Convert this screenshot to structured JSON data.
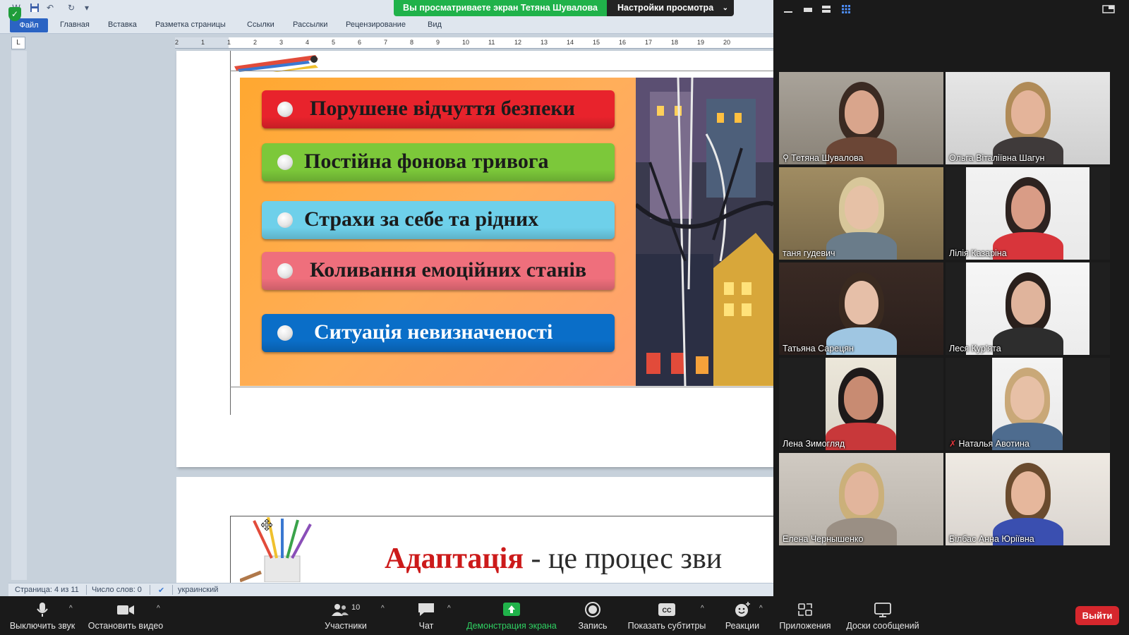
{
  "banner": {
    "viewing_text": "Вы просматриваете экран Тетяна Шувалова",
    "view_settings_label": "Настройки просмотра"
  },
  "word": {
    "tabs": {
      "file": "Файл",
      "home": "Главная",
      "insert": "Вставка",
      "layout": "Разметка страницы",
      "references": "Ссылки",
      "mailings": "Рассылки",
      "review": "Рецензирование",
      "view": "Вид"
    },
    "ruler_corner": "L",
    "ruler_numbers": [
      "2",
      "1",
      "1",
      "2",
      "3",
      "4",
      "5",
      "6",
      "7",
      "8",
      "9",
      "10",
      "11",
      "12",
      "13",
      "14",
      "15",
      "16",
      "17",
      "18",
      "19",
      "20"
    ],
    "slide_items": [
      {
        "text": "Порушене відчуття безпеки",
        "color": "#e8232c"
      },
      {
        "text": "Постійна фонова тривога",
        "color": "#7cc83a"
      },
      {
        "text": "Страхи за себе та рідних",
        "color": "#6ed0ea"
      },
      {
        "text": "Коливання емоційних станів",
        "color": "#ef6f7c"
      },
      {
        "text": "Ситуація невизначеності",
        "color": "#0a6ec8"
      }
    ],
    "page2_heading_word": "Адаптація",
    "page2_heading_rest": " -   це процес зви",
    "status": {
      "page": "Страница: 4 из 11",
      "words": "Число слов: 0",
      "language": "украинский"
    }
  },
  "participants": [
    {
      "name": "Тетяна Шувалова",
      "icon": "pin-icon",
      "active": false
    },
    {
      "name": "Ольга Віталіївна Шагун",
      "icon": "",
      "active": false
    },
    {
      "name": "таня гудевич",
      "icon": "",
      "active": true
    },
    {
      "name": "Лілія Казаріна",
      "icon": "",
      "active": false
    },
    {
      "name": "Татьяна Сарецян",
      "icon": "",
      "active": false
    },
    {
      "name": "Леся Кур'ята",
      "icon": "",
      "active": false
    },
    {
      "name": "Лена Зимогляд",
      "icon": "",
      "active": false
    },
    {
      "name": "Наталья Авотина",
      "icon": "mic-muted-icon",
      "active": false
    },
    {
      "name": "Елена Чернышенко",
      "icon": "",
      "active": false
    },
    {
      "name": "Білбас Анна Юріївна",
      "icon": "",
      "active": false
    }
  ],
  "toolbar": {
    "mute": "Выключить звук",
    "video": "Остановить видео",
    "participants": "Участники",
    "participants_count": "10",
    "chat": "Чат",
    "share": "Демонстрация экрана",
    "record": "Запись",
    "captions": "Показать субтитры",
    "reactions": "Реакции",
    "apps": "Приложения",
    "whiteboards": "Доски сообщений",
    "leave": "Выйти"
  },
  "colors": {
    "share_green": "#20b24a",
    "active_speaker": "#d9e15a",
    "leave_red": "#d6272d",
    "word_blue": "#2b64c3"
  }
}
